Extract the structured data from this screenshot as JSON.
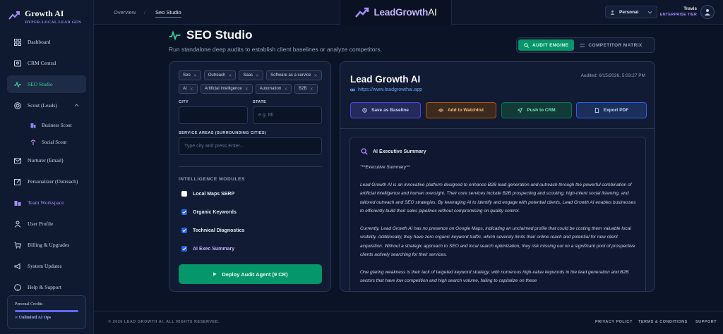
{
  "brand": {
    "title": "Growth AI",
    "subtitle": "HYPER-LOCAL LEAD GEN"
  },
  "sidebar": {
    "items": [
      {
        "label": "Dashboard",
        "icon": "grid-icon"
      },
      {
        "label": "CRM Central",
        "icon": "crm-icon"
      },
      {
        "label": "SEO Studio",
        "icon": "seo-pulse-icon",
        "active": true
      },
      {
        "label": "Scout (Leads)",
        "icon": "target-icon"
      },
      {
        "label": "Nurturer (Email)",
        "icon": "mail-icon"
      },
      {
        "label": "Personalizer (Outreach)",
        "icon": "edit-icon"
      },
      {
        "label": "Team Workspace",
        "icon": "team-icon"
      },
      {
        "label": "User Profile",
        "icon": "user-icon"
      },
      {
        "label": "Billing & Upgrades",
        "icon": "cart-icon"
      },
      {
        "label": "System Updates",
        "icon": "megaphone-icon"
      },
      {
        "label": "Help & Support",
        "icon": "help-icon"
      }
    ],
    "subitems": [
      {
        "label": "Business Scout",
        "icon": "building-icon"
      },
      {
        "label": "Social Scout",
        "icon": "antenna-icon"
      }
    ],
    "credits": {
      "label": "Personal Credits",
      "value": "∞ Unlimited AI Ops"
    }
  },
  "topbar": {
    "breadcrumb": [
      "Overview",
      "Seo Studio"
    ],
    "logo": {
      "bold": "LeadGrowth",
      "light": "AI"
    },
    "workspace": "Personal",
    "user": {
      "name": "Travis",
      "tier": "ENTERPRISE TIER"
    }
  },
  "page": {
    "title": "SEO Studio",
    "subtitle": "Run standalone deep audits to establish client baselines or analyze competitors.",
    "modes": [
      "AUDIT ENGINE",
      "COMPETITOR MATRIX"
    ]
  },
  "form": {
    "tags": [
      "Seo",
      "Outreach",
      "Saas",
      "Software as a service",
      "AI",
      "Artificial Intelligence",
      "Automation",
      "B2B"
    ],
    "city_label": "CITY",
    "city_value": "",
    "state_label": "STATE",
    "state_placeholder": "e.g. MI",
    "areas_label": "SERVICE AREAS (SURROUNDING CITIES)",
    "areas_placeholder": "Type city and press Enter...",
    "modules_title": "INTELLIGENCE MODULES",
    "modules": [
      {
        "label": "Local Maps SERP",
        "checked": false
      },
      {
        "label": "Organic Keywords",
        "checked": true
      },
      {
        "label": "Technical Diagnostics",
        "checked": true
      },
      {
        "label": "AI Exec Summary",
        "checked": true
      }
    ],
    "deploy_label": "Deploy Audit Agent (9 CR)"
  },
  "report": {
    "title": "Lead Growth AI",
    "url": "https://www.leadgrowthai.app",
    "audited": "Audited: 6/15/2026, 5:03:27 PM",
    "actions": [
      "Save as Baseline",
      "Add to Watchlist",
      "Push to CRM",
      "Export PDF"
    ],
    "summary_title": "AI Executive Summary",
    "summary": [
      "\"**Executive Summary**",
      "Lead Growth AI is an innovative platform designed to enhance B2B lead generation and outreach through the powerful combination of artificial intelligence and human oversight. Their core services include B2B prospecting and scouting, high-intent social listening, and tailored outreach and SEO strategies. By leveraging AI to identify and engage with potential clients, Lead Growth AI enables businesses to efficiently build their sales pipelines without compromising on quality control.",
      "Currently, Lead Growth AI has no presence on Google Maps, indicating an unclaimed profile that could be costing them valuable local visibility. Additionally, they have zero organic keyword traffic, which severely limits their online reach and potential for new client acquisition. Without a strategic approach to SEO and local search optimization, they risk missing out on a significant pool of prospective clients actively searching for their services.",
      "One glaring weakness is their lack of targeted keyword strategy; with numerous high-value keywords in the lead generation and B2B sectors that have low competition and high search volume, failing to capitalize on these"
    ]
  },
  "footer": {
    "copyright": "© 2026 LEAD GROWTH AI. ALL RIGHTS RESERVED.",
    "links": [
      "PRIVACY POLICY",
      "TERMS & CONDITIONS",
      "SUPPORT"
    ]
  },
  "colors": {
    "accent": "#34d399",
    "brand_purple": "#a78bfa",
    "primary_btn": "#059669",
    "background": "#0b1326"
  }
}
